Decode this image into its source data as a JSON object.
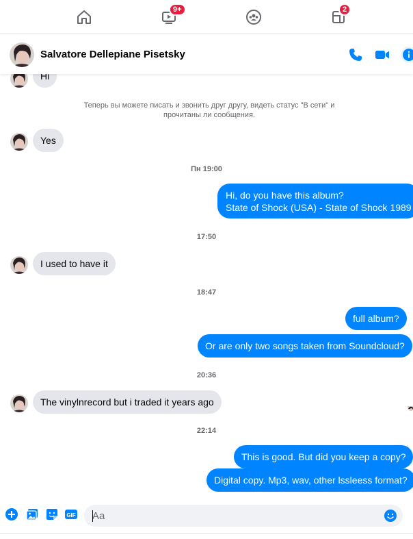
{
  "nav": {
    "video_badge": "9+",
    "pages_badge": "2"
  },
  "header": {
    "contact_name": "Salvatore Dellepiane Pisetsky"
  },
  "messages": {
    "first_in": "Hi",
    "system_note": "Теперь вы можете писать и звонить друг другу, видеть статус \"В сети\" и прочитаны ли сообщения.",
    "yes": "Yes",
    "stamp1": "Пн 19:00",
    "out1_line1": "Hi, do you have this album?",
    "out1_line2": "State of Shock (USA) - State of Shock 1989",
    "stamp2": "17:50",
    "in2": "I used to have it",
    "stamp3": "18:47",
    "out2": "full album?",
    "out3": "Or are only two songs taken from Soundcloud?",
    "stamp4": "20:36",
    "in3": "The vinylnrecord but i traded it years ago",
    "stamp5": "22:14",
    "out4": "This is good. But did you keep a copy?",
    "out5": "Digital copy. Mp3, wav, other lssleess format?"
  },
  "composer": {
    "placeholder": "Aa",
    "gif_label": "GIF"
  },
  "colors": {
    "accent": "#0084ff",
    "incoming_bubble": "#e4e6eb",
    "badge": "#e41e3f",
    "icon_blue": "#0084ff"
  },
  "icons": {
    "home": "home-icon",
    "watch": "video-icon",
    "groups": "groups-icon",
    "pages": "pages-icon",
    "call": "phone-icon",
    "video_call": "video-camera-icon",
    "info": "info-icon",
    "more": "plus-icon",
    "photo": "photo-icon",
    "sticker": "sticker-icon",
    "gif": "gif-icon",
    "emoji": "emoji-icon"
  }
}
